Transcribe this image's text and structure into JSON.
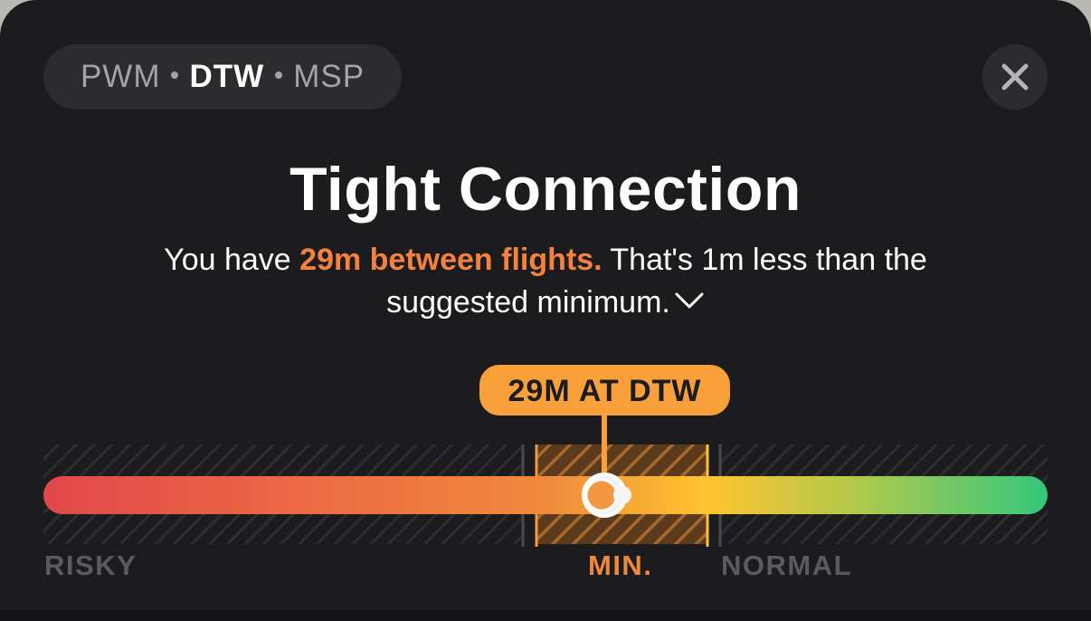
{
  "route": {
    "stops": [
      "PWM",
      "DTW",
      "MSP"
    ],
    "current_index": 1
  },
  "close_button": {
    "icon": "close-icon"
  },
  "title": "Tight Connection",
  "subtitle": {
    "prefix": "You have ",
    "highlight": "29m between flights.",
    "suffix": " That's 1m less than the suggested minimum.",
    "icon": "chevron-down-icon"
  },
  "timeline": {
    "marker_label": "29M AT DTW",
    "marker_value_minutes": 29,
    "minimum_minutes": 30,
    "labels": {
      "risky": "RISKY",
      "min": "MIN.",
      "normal": "NORMAL"
    },
    "colors": {
      "risky": "#e2474a",
      "mid": "#f08a3c",
      "min": "#fec32f",
      "normal": "#34c77b",
      "accent": "#f9a03a",
      "label_muted": "#5a5a5f",
      "label_min": "#f0873e"
    }
  }
}
